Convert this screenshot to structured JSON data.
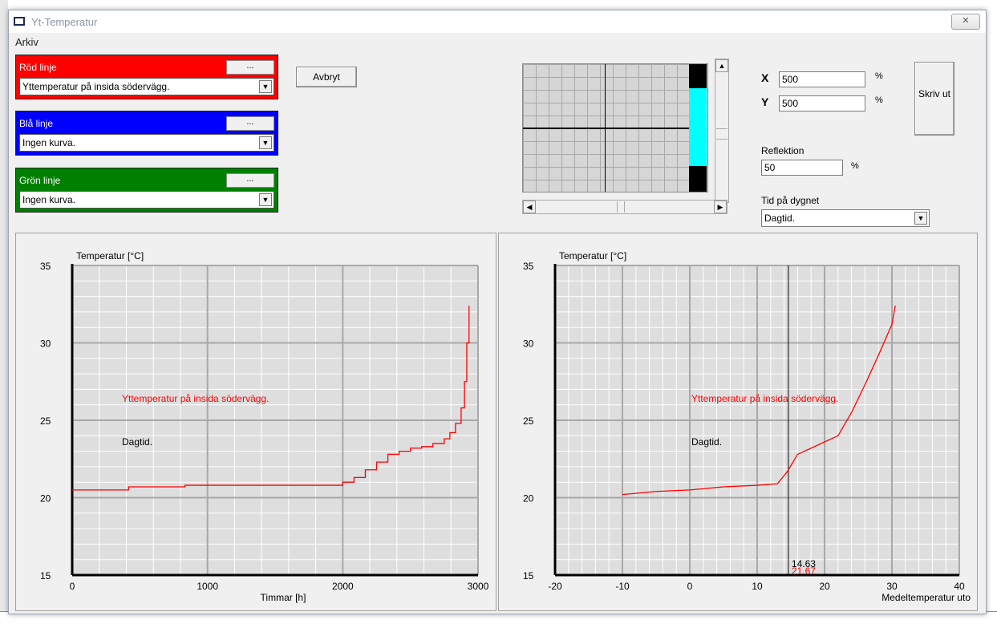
{
  "window": {
    "title": "Yt-Temperatur",
    "close_label": "✕",
    "menu": [
      "Arkiv"
    ]
  },
  "panels": {
    "red": {
      "label": "Röd linje",
      "dots": "...",
      "value": "Yttemperatur på insida södervägg.",
      "color": "#ff0000"
    },
    "blue": {
      "label": "Blå linje",
      "dots": "...",
      "value": "Ingen kurva.",
      "color": "#0000ff"
    },
    "green": {
      "label": "Grön linje",
      "dots": "...",
      "value": "Ingen kurva.",
      "color": "#008000"
    }
  },
  "buttons": {
    "cancel": "Avbryt",
    "print": "Skriv ut"
  },
  "position": {
    "x_label": "X",
    "x_value": "500",
    "y_label": "Y",
    "y_value": "500",
    "unit": "%"
  },
  "reflection": {
    "label": "Reflektion",
    "value": "50",
    "unit": "%"
  },
  "time_of_day": {
    "label": "Tid på dygnet",
    "value": "Dagtid."
  },
  "preview": {
    "accent": "#00ffff"
  },
  "chart_data": [
    {
      "type": "line",
      "ylabel": "Temperatur [°C]",
      "xlabel": "Timmar [h]",
      "xlim": [
        0,
        3600
      ],
      "ylim": [
        15,
        35
      ],
      "xticks": [
        "0",
        "1000",
        "2000",
        "3000"
      ],
      "yticks": [
        "15",
        "20",
        "25",
        "30",
        "35"
      ],
      "grid": true,
      "annotations": [
        "Yttemperatur på insida södervägg.",
        "Dagtid."
      ],
      "series": [
        {
          "color": "#ff0000",
          "x": [
            0,
            500,
            1000,
            1500,
            2000,
            2400,
            2500,
            2600,
            2700,
            2800,
            2900,
            3000,
            3100,
            3200,
            3300,
            3350,
            3400,
            3450,
            3480,
            3500,
            3520
          ],
          "y": [
            20.5,
            20.7,
            20.8,
            20.8,
            20.8,
            21.0,
            21.3,
            21.8,
            22.3,
            22.8,
            23.0,
            23.2,
            23.3,
            23.5,
            23.8,
            24.2,
            24.8,
            25.8,
            27.5,
            30.0,
            32.4
          ]
        }
      ]
    },
    {
      "type": "line",
      "ylabel": "Temperatur [°C]",
      "xlabel": "Medeltemperatur uto",
      "xlim": [
        -20,
        40
      ],
      "ylim": [
        15,
        35
      ],
      "xticks": [
        "-20",
        "-10",
        "0",
        "10",
        "20",
        "30",
        "40"
      ],
      "yticks": [
        "15",
        "20",
        "25",
        "30",
        "35"
      ],
      "grid": true,
      "cursor": {
        "x": 14.63,
        "x_text": "14.63",
        "y_text": "21.67"
      },
      "annotations": [
        "Yttemperatur på insida södervägg.",
        "Dagtid."
      ],
      "series": [
        {
          "color": "#ff0000",
          "x": [
            -10,
            -5,
            0,
            5,
            10,
            13,
            14.5,
            16,
            18,
            20,
            22,
            24,
            26,
            28,
            30,
            30.5
          ],
          "y": [
            20.2,
            20.4,
            20.5,
            20.7,
            20.8,
            20.9,
            21.7,
            22.8,
            23.2,
            23.6,
            24.0,
            25.5,
            27.3,
            29.2,
            31.2,
            32.4
          ]
        }
      ]
    }
  ]
}
